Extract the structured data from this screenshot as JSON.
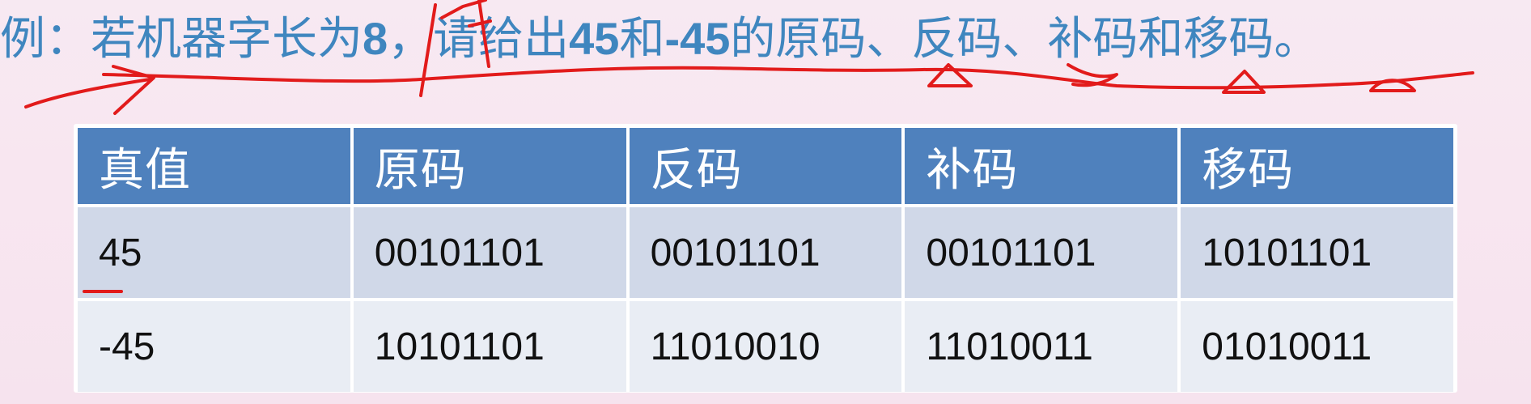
{
  "heading": {
    "prefix": "例：若机器字长为",
    "word_length": "8",
    "mid1": "，请给出",
    "value_pos": "45",
    "mid2": "和",
    "value_neg": "-45",
    "suffix": "的原码、反码、补码和移码。"
  },
  "table": {
    "headers": [
      "真值",
      "原码",
      "反码",
      "补码",
      "移码"
    ],
    "rows": [
      [
        "45",
        "00101101",
        "00101101",
        "00101101",
        "10101101"
      ],
      [
        "-45",
        "10101101",
        "11010010",
        "11010011",
        "01010011"
      ]
    ]
  },
  "colors": {
    "heading_text": "#3f86bf",
    "header_bg": "#4f81bd",
    "row1_bg": "#d0d8e8",
    "row2_bg": "#e9edf4",
    "annotation_ink": "#e21b1b"
  }
}
